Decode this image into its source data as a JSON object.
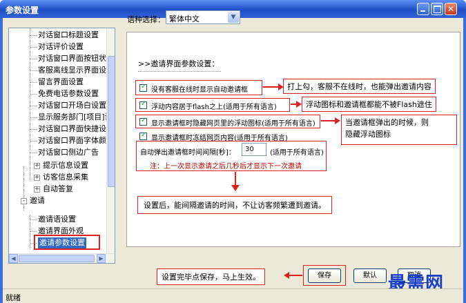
{
  "window": {
    "title": "参数设置",
    "status": "就绪"
  },
  "tree": {
    "items": [
      {
        "label": "对话窗口标题设置"
      },
      {
        "label": "对话评价设置"
      },
      {
        "label": "对话窗口界面按钮状态"
      },
      {
        "label": "客服离线显示界面设置"
      },
      {
        "label": "留言界面设置"
      },
      {
        "label": "免费电话参数设置"
      },
      {
        "label": "对话窗口开场白设置"
      },
      {
        "label": "显示服务部门[项目]设"
      },
      {
        "label": "对话窗口界面快捷设置"
      },
      {
        "label": "对话窗口界面字体颜色"
      },
      {
        "label": "对话窗口侧边广告"
      },
      {
        "label": "提示信息设置"
      },
      {
        "label": "访客信息采集"
      },
      {
        "label": "自动答复"
      },
      {
        "label": "邀请"
      },
      {
        "label": "邀请语设置"
      },
      {
        "label": "邀请界面外观"
      },
      {
        "label": "邀请参数设置"
      }
    ],
    "expander_plus": "+",
    "expander_minus": "-"
  },
  "language": {
    "label": "语种选择：",
    "value": "繁体中文"
  },
  "section": {
    "title": ">>邀请界面参数设置："
  },
  "options": [
    {
      "label": "没有客服在线时显示自动邀请框",
      "checked": true
    },
    {
      "label": "浮动内容居于flash之上(适用于所有语言)",
      "checked": true
    },
    {
      "label": "显示邀请框时隐藏网页里的浮动图标(适用于所有语言)",
      "checked": true
    },
    {
      "label": "显示邀请框时冻结网页内容(适用于所有语言)",
      "checked": true
    }
  ],
  "interval": {
    "label": "自动弹出邀请框时间间隔[秒]：",
    "value": "30",
    "suffix": "(适用于所有语言)",
    "note": "注：上一次显示邀请之后几秒后才显示下一次邀请"
  },
  "callouts": {
    "c1": "打上勾，客服不在线时，也能弹出邀请内容",
    "c2": "浮动图标和邀请框都能不被Flash遮住",
    "c3_line1": "当邀请框弹出的时候，则",
    "c3_line2": "隐藏浮动图标",
    "c4": "设置后，能间隔邀请的时间，不让访客频繁遭到邀请。",
    "c5": "设置完毕点保存，马上生效。"
  },
  "buttons": {
    "save": "保存",
    "default": "默认",
    "cancel": "取消"
  },
  "watermark": "最需网",
  "colors": {
    "title_bar": "#2a5cd0",
    "callout_red": "#e02020",
    "selection": "#316ac5",
    "watermark": "#1a40c8"
  }
}
